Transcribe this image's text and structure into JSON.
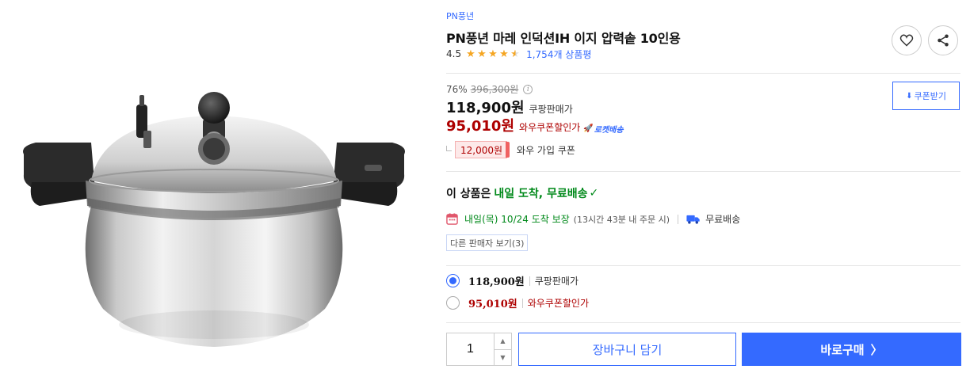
{
  "product": {
    "brand": "PN풍년",
    "title": "PN풍년 마레 인덕션IH 이지 압력솥 10인용",
    "rating": "4.5",
    "stars": {
      "full": 4,
      "half": 1,
      "max": 5
    },
    "review_count": "1,754개 상품평",
    "image_alt": "stainless steel pressure cooker"
  },
  "icons": {
    "favorite": "heart-icon",
    "share": "share-icon",
    "info": "info-icon",
    "calendar": "calendar-icon",
    "truck": "truck-icon",
    "rocket": "rocket-icon",
    "check": "check-icon"
  },
  "pricing": {
    "discount_rate": "76%",
    "original_price": "396,300원",
    "sale_price": "118,900원",
    "sale_label": "쿠팡판매가",
    "coupon_price": "95,010원",
    "coupon_label": "와우쿠폰할인가",
    "rocket_label": "로켓배송",
    "coupon_button": "쿠폰받기",
    "coupon_amount": "12,000원",
    "coupon_desc": "와우 가입 쿠폰"
  },
  "delivery": {
    "headline_prefix": "이 상품은",
    "headline_main": "내일 도착, 무료배송",
    "check": "✓",
    "eta_date": "내일(목) 10/24 도착 보장",
    "eta_cutoff": "(13시간 43분 내 주문 시)",
    "free_shipping": "무료배송",
    "other_sellers": "다른 판매자 보기(3)"
  },
  "options": [
    {
      "price": "118,900원",
      "label": "쿠팡판매가",
      "selected": true
    },
    {
      "price": "95,010원",
      "label": "와우쿠폰할인가",
      "selected": false
    }
  ],
  "purchase": {
    "quantity": "1",
    "cart_button": "장바구니 담기",
    "buy_button": "바로구매",
    "buy_chevron": "〉"
  },
  "colors": {
    "accent": "#346aff",
    "discount_red": "#ae0000",
    "delivery_green": "#00891a",
    "star": "#f5a623"
  }
}
